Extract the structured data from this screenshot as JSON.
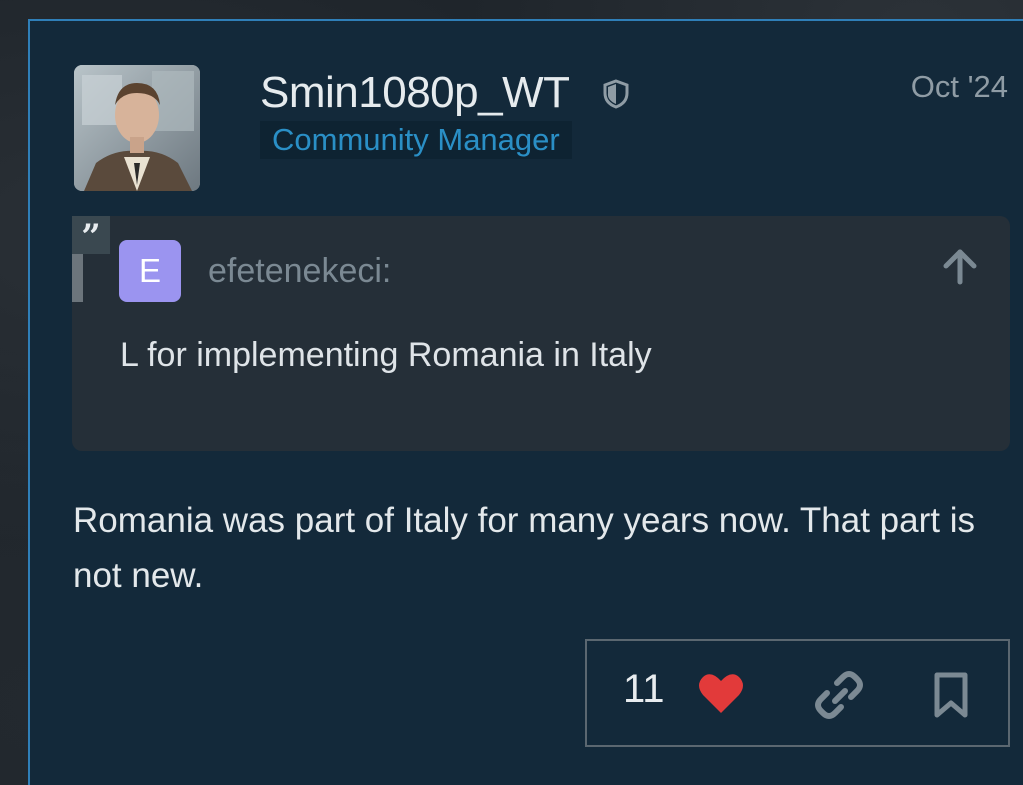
{
  "post": {
    "username": "Smin1080p_WT",
    "user_title": "Community Manager",
    "date": "Oct '24",
    "body": "Romania was part of Italy for many years now. That part is not new."
  },
  "quote": {
    "avatar_letter": "E",
    "author": "efetenekeci:",
    "text": "L for implementing Romania in Italy"
  },
  "actions": {
    "like_count": "11"
  },
  "colors": {
    "post_bg": "#13293a",
    "accent": "#2f7fb8",
    "heart": "#e23a3a",
    "quote_avatar": "#9b94f0"
  }
}
